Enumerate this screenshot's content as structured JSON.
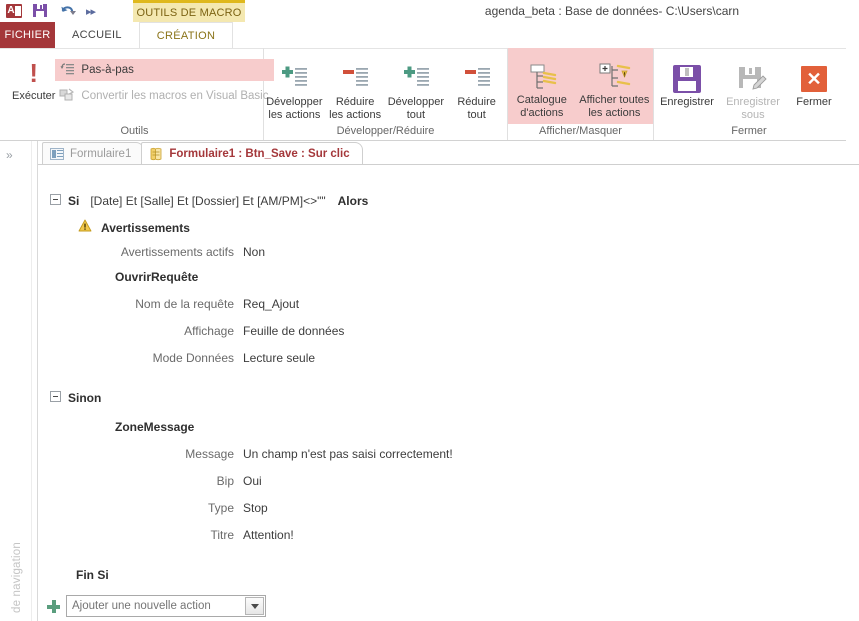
{
  "window": {
    "title": "agenda_beta : Base de données- C:\\Users\\carn",
    "contextual_tab": "OUTILS DE MACRO"
  },
  "quick_access": {
    "items": [
      {
        "name": "access-icon",
        "label": "A"
      },
      {
        "name": "save-icon",
        "label": "Enregistrer"
      },
      {
        "name": "undo-icon",
        "label": "Annuler"
      },
      {
        "name": "customize-icon",
        "label": "»"
      }
    ]
  },
  "ribbon_tabs": [
    {
      "id": "fichier",
      "label": "FICHIER",
      "active": false,
      "file": true
    },
    {
      "id": "accueil",
      "label": "ACCUEIL",
      "active": false
    },
    {
      "id": "creation",
      "label": "CRÉATION",
      "active": true
    }
  ],
  "ribbon": {
    "groups": [
      {
        "id": "outils",
        "label": "Outils",
        "run_button": "Exécuter",
        "small_buttons": [
          {
            "id": "pas-a-pas",
            "label": "Pas-à-pas",
            "selected": true,
            "disabled": false
          },
          {
            "id": "convertir",
            "label": "Convertir les macros en Visual Basic",
            "selected": false,
            "disabled": true
          }
        ]
      },
      {
        "id": "developper-reduire",
        "label": "Développer/Réduire",
        "buttons": [
          {
            "id": "developper-actions",
            "line1": "Développer",
            "line2": "les actions",
            "icon": "expand-actions-icon"
          },
          {
            "id": "reduire-actions",
            "line1": "Réduire",
            "line2": "les actions",
            "icon": "collapse-actions-icon"
          },
          {
            "id": "developper-tout",
            "line1": "Développer",
            "line2": "tout",
            "icon": "expand-all-icon"
          },
          {
            "id": "reduire-tout",
            "line1": "Réduire",
            "line2": "tout",
            "icon": "collapse-all-icon"
          }
        ]
      },
      {
        "id": "afficher-masquer",
        "label": "Afficher/Masquer",
        "buttons": [
          {
            "id": "catalogue-actions",
            "line1": "Catalogue",
            "line2": "d'actions",
            "icon": "action-catalog-icon",
            "selected": true
          },
          {
            "id": "afficher-toutes-actions",
            "line1": "Afficher toutes",
            "line2": "les actions",
            "icon": "show-all-actions-icon",
            "selected": true
          }
        ]
      },
      {
        "id": "fermer",
        "label": "Fermer",
        "buttons": [
          {
            "id": "enregistrer",
            "line1": "Enregistrer",
            "line2": "",
            "icon": "save-floppy-icon",
            "disabled": false
          },
          {
            "id": "enregistrer-sous",
            "line1": "Enregistrer",
            "line2": "sous",
            "icon": "save-as-icon",
            "disabled": true
          },
          {
            "id": "fermer",
            "line1": "Fermer",
            "line2": "",
            "icon": "close-x-icon",
            "disabled": false
          }
        ]
      }
    ]
  },
  "navigation_pane": {
    "collapse_icon": "»",
    "vertical_label": "de navigation"
  },
  "document_tabs": [
    {
      "id": "formulaire1",
      "label": "Formulaire1",
      "icon": "form-icon",
      "active": false
    },
    {
      "id": "btn-save-onclick",
      "label": "Formulaire1 : Btn_Save : Sur clic",
      "icon": "macro-icon",
      "active": true
    }
  ],
  "macro": {
    "if_keyword": "Si",
    "if_condition": "[Date] Et [Salle] Et [Dossier] Et [AM/PM]<>\"\"",
    "then_keyword": "Alors",
    "warnings_block": {
      "title": "Avertissements",
      "param_label": "Avertissements actifs",
      "param_value": "Non"
    },
    "openquery_block": {
      "title": "OuvrirRequête",
      "params": [
        {
          "label": "Nom de la requête",
          "value": "Req_Ajout"
        },
        {
          "label": "Affichage",
          "value": "Feuille de données"
        },
        {
          "label": "Mode Données",
          "value": "Lecture seule"
        }
      ]
    },
    "else_keyword": "Sinon",
    "msgbox_block": {
      "title": "ZoneMessage",
      "params": [
        {
          "label": "Message",
          "value": "Un champ n'est pas saisi correctement!"
        },
        {
          "label": "Bip",
          "value": "Oui"
        },
        {
          "label": "Type",
          "value": "Stop"
        },
        {
          "label": "Titre",
          "value": "Attention!"
        }
      ]
    },
    "endif_keyword": "Fin Si",
    "add_action": {
      "placeholder": "Ajouter une nouvelle action",
      "value": ""
    }
  },
  "colors": {
    "accent_red": "#a4373a",
    "contextual_gold": "#dfb81c",
    "selected_pink": "#f7cccc",
    "save_purple": "#7b4fa8",
    "close_orange": "#e2603a",
    "green_plus": "#4c9a82",
    "red_minus": "#d1503a"
  }
}
